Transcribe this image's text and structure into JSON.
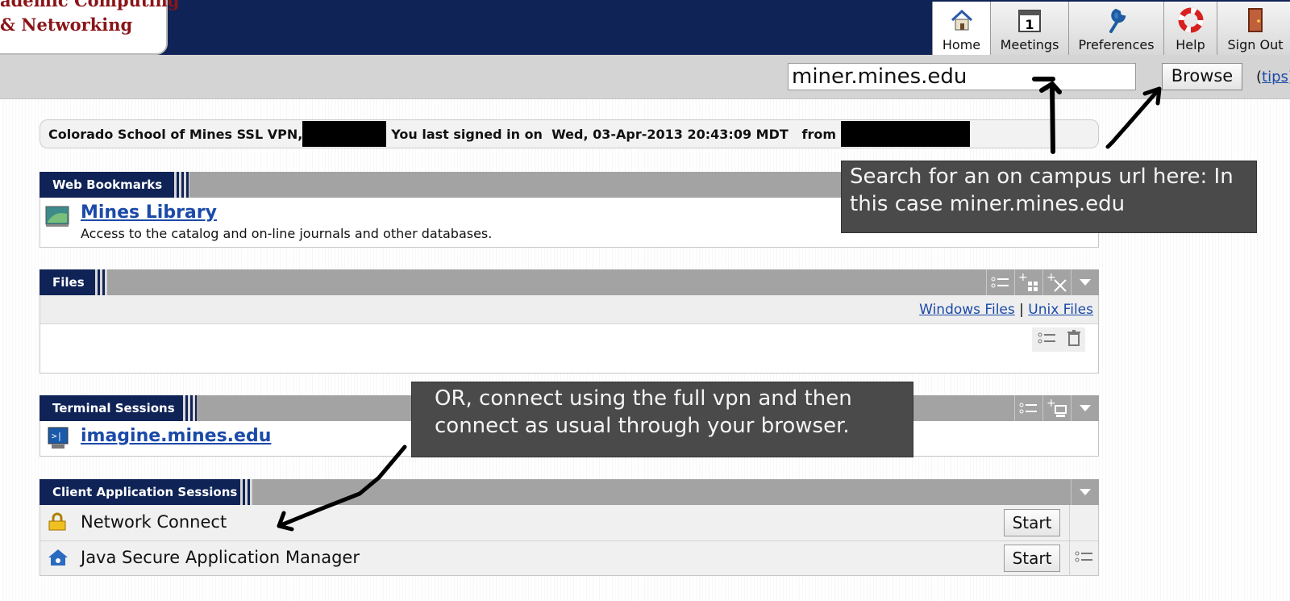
{
  "logo": {
    "line1": "ademic Computing",
    "line2": "& Networking"
  },
  "nav": {
    "home": "Home",
    "meetings": "Meetings",
    "preferences": "Preferences",
    "help": "Help",
    "sign_out": "Sign Out"
  },
  "search": {
    "value": "miner.mines.edu",
    "browse_label": "Browse",
    "tips_prefix": "(",
    "tips_label": "tips",
    "tips_suffix": ")"
  },
  "welcome": {
    "prefix": "Colorado School of Mines SSL VPN,",
    "last_signed": "You last signed in on  Wed, 03-Apr-2013 20:43:09 MDT   from"
  },
  "web_bookmarks": {
    "title": "Web Bookmarks",
    "item_name": "Mines Library",
    "item_desc": "Access to the catalog and on-line journals and other databases."
  },
  "files": {
    "title": "Files",
    "windows_link": "Windows Files",
    "separator": "|",
    "unix_link": "Unix Files"
  },
  "terminal": {
    "title": "Terminal Sessions",
    "item_name": "imagine.mines.edu"
  },
  "client_apps": {
    "title": "Client Application Sessions",
    "items": [
      {
        "name": "Network Connect",
        "button": "Start"
      },
      {
        "name": "Java Secure Application Manager",
        "button": "Start"
      }
    ]
  },
  "annotations": {
    "search_note": "Search for an on campus url here: In this case miner.mines.edu",
    "vpn_note": "OR, connect using the full vpn and then connect as usual through your browser."
  },
  "colors": {
    "navy": "#0f2356",
    "logo_red": "#8a1418",
    "link_blue": "#1b4aa8",
    "header_gray": "#a3a3a3"
  }
}
